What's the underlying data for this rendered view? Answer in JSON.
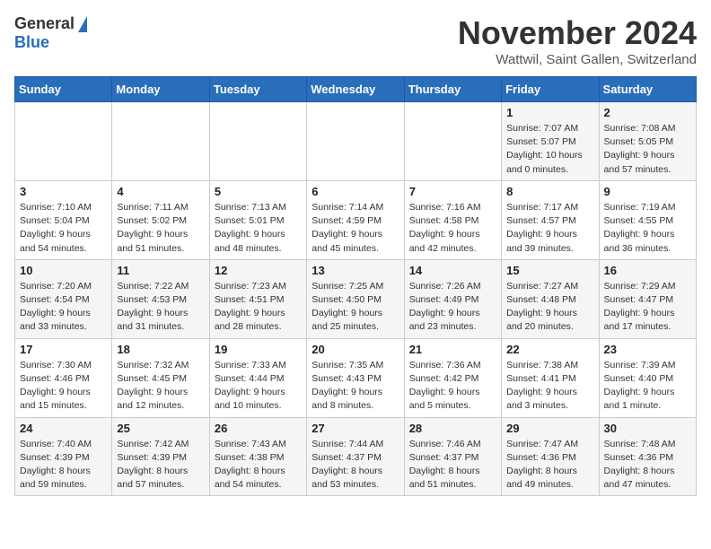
{
  "header": {
    "logo_general": "General",
    "logo_blue": "Blue",
    "month_title": "November 2024",
    "location": "Wattwil, Saint Gallen, Switzerland"
  },
  "calendar": {
    "days_of_week": [
      "Sunday",
      "Monday",
      "Tuesday",
      "Wednesday",
      "Thursday",
      "Friday",
      "Saturday"
    ],
    "weeks": [
      [
        {
          "day": "",
          "info": ""
        },
        {
          "day": "",
          "info": ""
        },
        {
          "day": "",
          "info": ""
        },
        {
          "day": "",
          "info": ""
        },
        {
          "day": "",
          "info": ""
        },
        {
          "day": "1",
          "info": "Sunrise: 7:07 AM\nSunset: 5:07 PM\nDaylight: 10 hours\nand 0 minutes."
        },
        {
          "day": "2",
          "info": "Sunrise: 7:08 AM\nSunset: 5:05 PM\nDaylight: 9 hours\nand 57 minutes."
        }
      ],
      [
        {
          "day": "3",
          "info": "Sunrise: 7:10 AM\nSunset: 5:04 PM\nDaylight: 9 hours\nand 54 minutes."
        },
        {
          "day": "4",
          "info": "Sunrise: 7:11 AM\nSunset: 5:02 PM\nDaylight: 9 hours\nand 51 minutes."
        },
        {
          "day": "5",
          "info": "Sunrise: 7:13 AM\nSunset: 5:01 PM\nDaylight: 9 hours\nand 48 minutes."
        },
        {
          "day": "6",
          "info": "Sunrise: 7:14 AM\nSunset: 4:59 PM\nDaylight: 9 hours\nand 45 minutes."
        },
        {
          "day": "7",
          "info": "Sunrise: 7:16 AM\nSunset: 4:58 PM\nDaylight: 9 hours\nand 42 minutes."
        },
        {
          "day": "8",
          "info": "Sunrise: 7:17 AM\nSunset: 4:57 PM\nDaylight: 9 hours\nand 39 minutes."
        },
        {
          "day": "9",
          "info": "Sunrise: 7:19 AM\nSunset: 4:55 PM\nDaylight: 9 hours\nand 36 minutes."
        }
      ],
      [
        {
          "day": "10",
          "info": "Sunrise: 7:20 AM\nSunset: 4:54 PM\nDaylight: 9 hours\nand 33 minutes."
        },
        {
          "day": "11",
          "info": "Sunrise: 7:22 AM\nSunset: 4:53 PM\nDaylight: 9 hours\nand 31 minutes."
        },
        {
          "day": "12",
          "info": "Sunrise: 7:23 AM\nSunset: 4:51 PM\nDaylight: 9 hours\nand 28 minutes."
        },
        {
          "day": "13",
          "info": "Sunrise: 7:25 AM\nSunset: 4:50 PM\nDaylight: 9 hours\nand 25 minutes."
        },
        {
          "day": "14",
          "info": "Sunrise: 7:26 AM\nSunset: 4:49 PM\nDaylight: 9 hours\nand 23 minutes."
        },
        {
          "day": "15",
          "info": "Sunrise: 7:27 AM\nSunset: 4:48 PM\nDaylight: 9 hours\nand 20 minutes."
        },
        {
          "day": "16",
          "info": "Sunrise: 7:29 AM\nSunset: 4:47 PM\nDaylight: 9 hours\nand 17 minutes."
        }
      ],
      [
        {
          "day": "17",
          "info": "Sunrise: 7:30 AM\nSunset: 4:46 PM\nDaylight: 9 hours\nand 15 minutes."
        },
        {
          "day": "18",
          "info": "Sunrise: 7:32 AM\nSunset: 4:45 PM\nDaylight: 9 hours\nand 12 minutes."
        },
        {
          "day": "19",
          "info": "Sunrise: 7:33 AM\nSunset: 4:44 PM\nDaylight: 9 hours\nand 10 minutes."
        },
        {
          "day": "20",
          "info": "Sunrise: 7:35 AM\nSunset: 4:43 PM\nDaylight: 9 hours\nand 8 minutes."
        },
        {
          "day": "21",
          "info": "Sunrise: 7:36 AM\nSunset: 4:42 PM\nDaylight: 9 hours\nand 5 minutes."
        },
        {
          "day": "22",
          "info": "Sunrise: 7:38 AM\nSunset: 4:41 PM\nDaylight: 9 hours\nand 3 minutes."
        },
        {
          "day": "23",
          "info": "Sunrise: 7:39 AM\nSunset: 4:40 PM\nDaylight: 9 hours\nand 1 minute."
        }
      ],
      [
        {
          "day": "24",
          "info": "Sunrise: 7:40 AM\nSunset: 4:39 PM\nDaylight: 8 hours\nand 59 minutes."
        },
        {
          "day": "25",
          "info": "Sunrise: 7:42 AM\nSunset: 4:39 PM\nDaylight: 8 hours\nand 57 minutes."
        },
        {
          "day": "26",
          "info": "Sunrise: 7:43 AM\nSunset: 4:38 PM\nDaylight: 8 hours\nand 54 minutes."
        },
        {
          "day": "27",
          "info": "Sunrise: 7:44 AM\nSunset: 4:37 PM\nDaylight: 8 hours\nand 53 minutes."
        },
        {
          "day": "28",
          "info": "Sunrise: 7:46 AM\nSunset: 4:37 PM\nDaylight: 8 hours\nand 51 minutes."
        },
        {
          "day": "29",
          "info": "Sunrise: 7:47 AM\nSunset: 4:36 PM\nDaylight: 8 hours\nand 49 minutes."
        },
        {
          "day": "30",
          "info": "Sunrise: 7:48 AM\nSunset: 4:36 PM\nDaylight: 8 hours\nand 47 minutes."
        }
      ]
    ]
  }
}
